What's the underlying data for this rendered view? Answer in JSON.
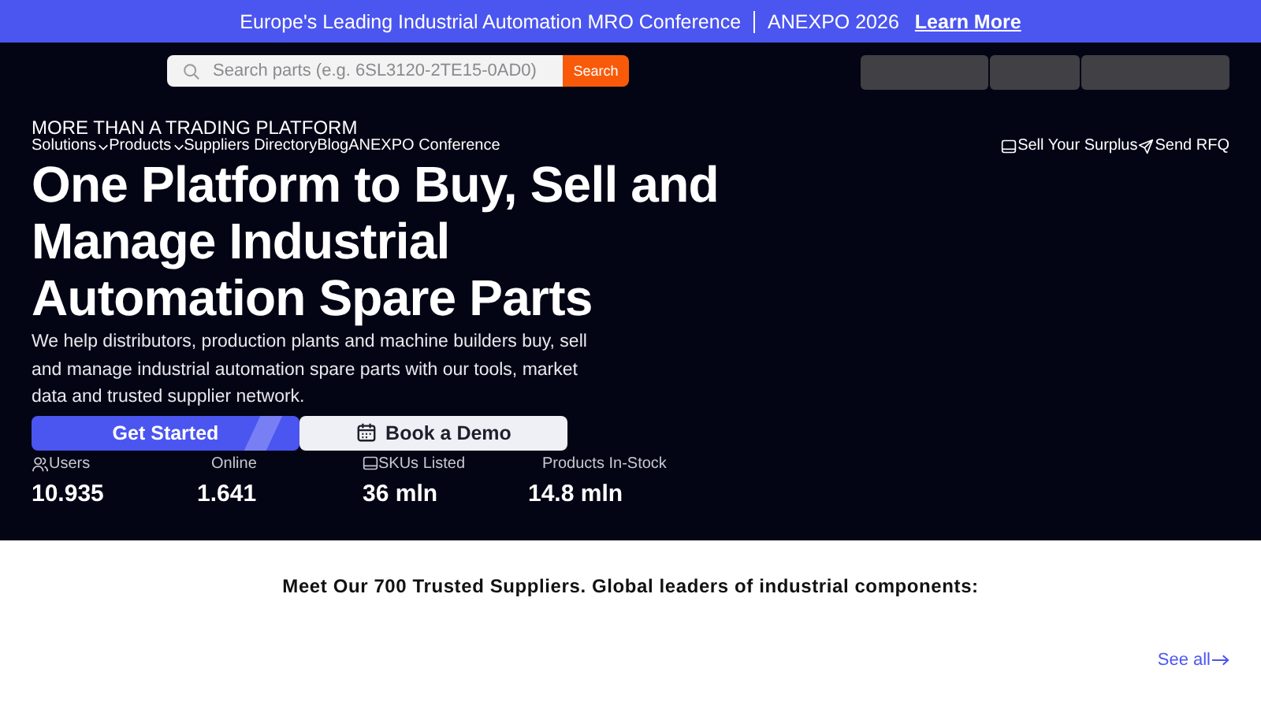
{
  "banner": {
    "text": "Europe's Leading Industrial Automation MRO Conference",
    "event": "ANEXPO 2026",
    "link": "Learn More"
  },
  "search": {
    "placeholder": "Search parts (e.g. 6SL3120-2TE15-0AD0)",
    "button": "Search"
  },
  "eyebrow": "MORE THAN A TRADING PLATFORM",
  "nav": [
    {
      "label": "Solutions",
      "dropdown": true
    },
    {
      "label": "Products",
      "dropdown": true
    },
    {
      "label": "Suppliers Directory",
      "dropdown": false
    },
    {
      "label": "Blog",
      "dropdown": false
    },
    {
      "label": "ANEXPO Conference",
      "dropdown": false
    }
  ],
  "actions": [
    {
      "label": "Sell Your Surplus",
      "kind": "box"
    },
    {
      "label": "Send RFQ",
      "kind": "send"
    }
  ],
  "hero": {
    "title": "One Platform to Buy, Sell and Manage Industrial Automation Spare Parts",
    "description": "We help distributors, production plants and machine builders buy, sell and manage industrial automation spare parts with our tools, market data and trusted supplier network.",
    "buttons": [
      {
        "label": "Get Started",
        "kind": "primary"
      },
      {
        "label": "Book a Demo",
        "kind": "calendar"
      }
    ]
  },
  "stats": [
    {
      "label": "Users",
      "value": "10.935",
      "kind": "users"
    },
    {
      "label": "Online",
      "value": "1.641",
      "kind": "plain"
    },
    {
      "label": "SKUs Listed",
      "value": "36 mln",
      "kind": "box"
    },
    {
      "label": "Products In-Stock",
      "value": "14.8 mln",
      "kind": "plain"
    }
  ],
  "suppliers": {
    "title": "Meet Our 700 Trusted Suppliers. Global leaders of industrial components:",
    "link": "See all"
  }
}
